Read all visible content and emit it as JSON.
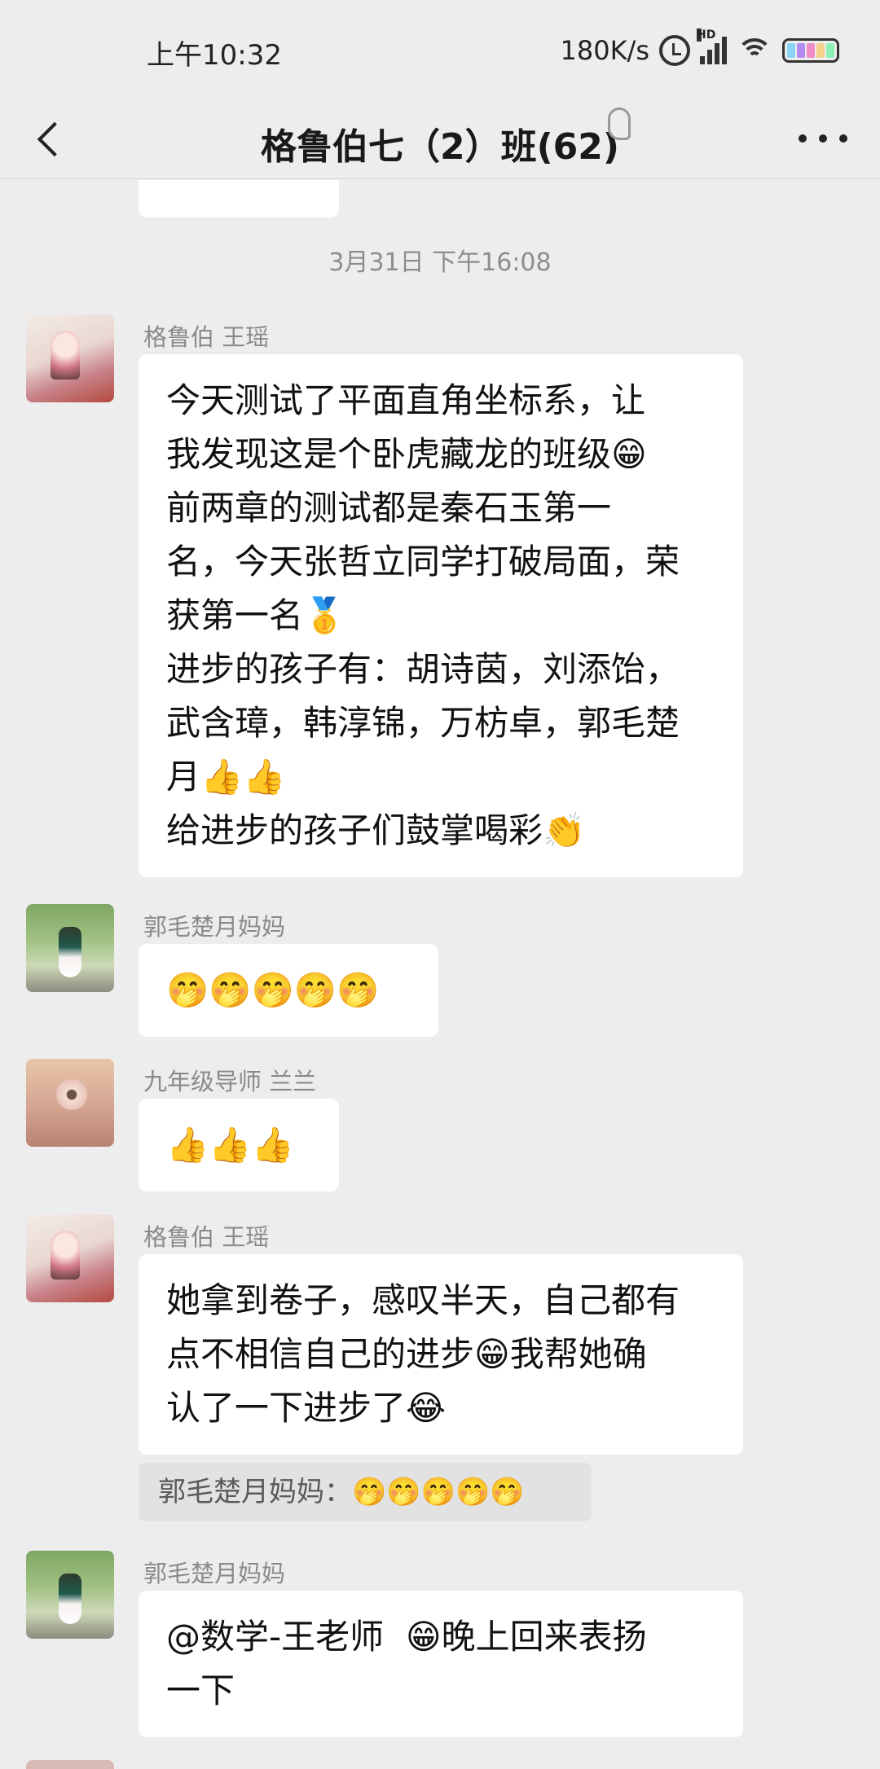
{
  "status_bar": {
    "time": "上午10:32",
    "net_speed": "180K/s",
    "hd_label": "HD",
    "icons": [
      "alarm-icon",
      "signal-icon",
      "wifi-icon",
      "battery-icon"
    ],
    "battery_colors": [
      "#8bd4f5",
      "#b48cf0",
      "#f08cc8",
      "#f5d28c",
      "#8cf0b4"
    ]
  },
  "header": {
    "back_icon": "chevron-left-icon",
    "title": "格鲁伯七（2）班(62)",
    "ear_icon": "ear-icon",
    "more_icon": "more-dots-icon"
  },
  "chat": {
    "timestamp": "3月31日 下午16:08",
    "messages": [
      {
        "sender": "格鲁伯 王瑶",
        "avatar": "opera-avatar",
        "text": "今天测试了平面直角坐标系，让\n我发现这是个卧虎藏龙的班级😁\n前两章的测试都是秦石玉第一\n名，今天张哲立同学打破局面，荣\n获第一名🥇\n进步的孩子有：胡诗茵，刘添饴，\n武含璋，韩淳锦，万枋卓，郭毛楚\n月👍👍\n给进步的孩子们鼓掌喝彩👏"
      },
      {
        "sender": "郭毛楚月妈妈",
        "avatar": "girl-avatar",
        "text": "🤭🤭🤭🤭🤭"
      },
      {
        "sender": "九年级导师 兰兰",
        "avatar": "flower-avatar",
        "text": "👍👍👍"
      },
      {
        "sender": "格鲁伯 王瑶",
        "avatar": "opera-avatar",
        "text": "她拿到卷子，感叹半天，自己都有\n点不相信自己的进步😁我帮她确\n认了一下进步了😂"
      },
      {
        "quote": "郭毛楚月妈妈：🤭🤭🤭🤭🤭"
      },
      {
        "sender": "郭毛楚月妈妈",
        "avatar": "girl-avatar",
        "text": "@数学-王老师  😁晚上回来表扬\n一下"
      }
    ]
  }
}
